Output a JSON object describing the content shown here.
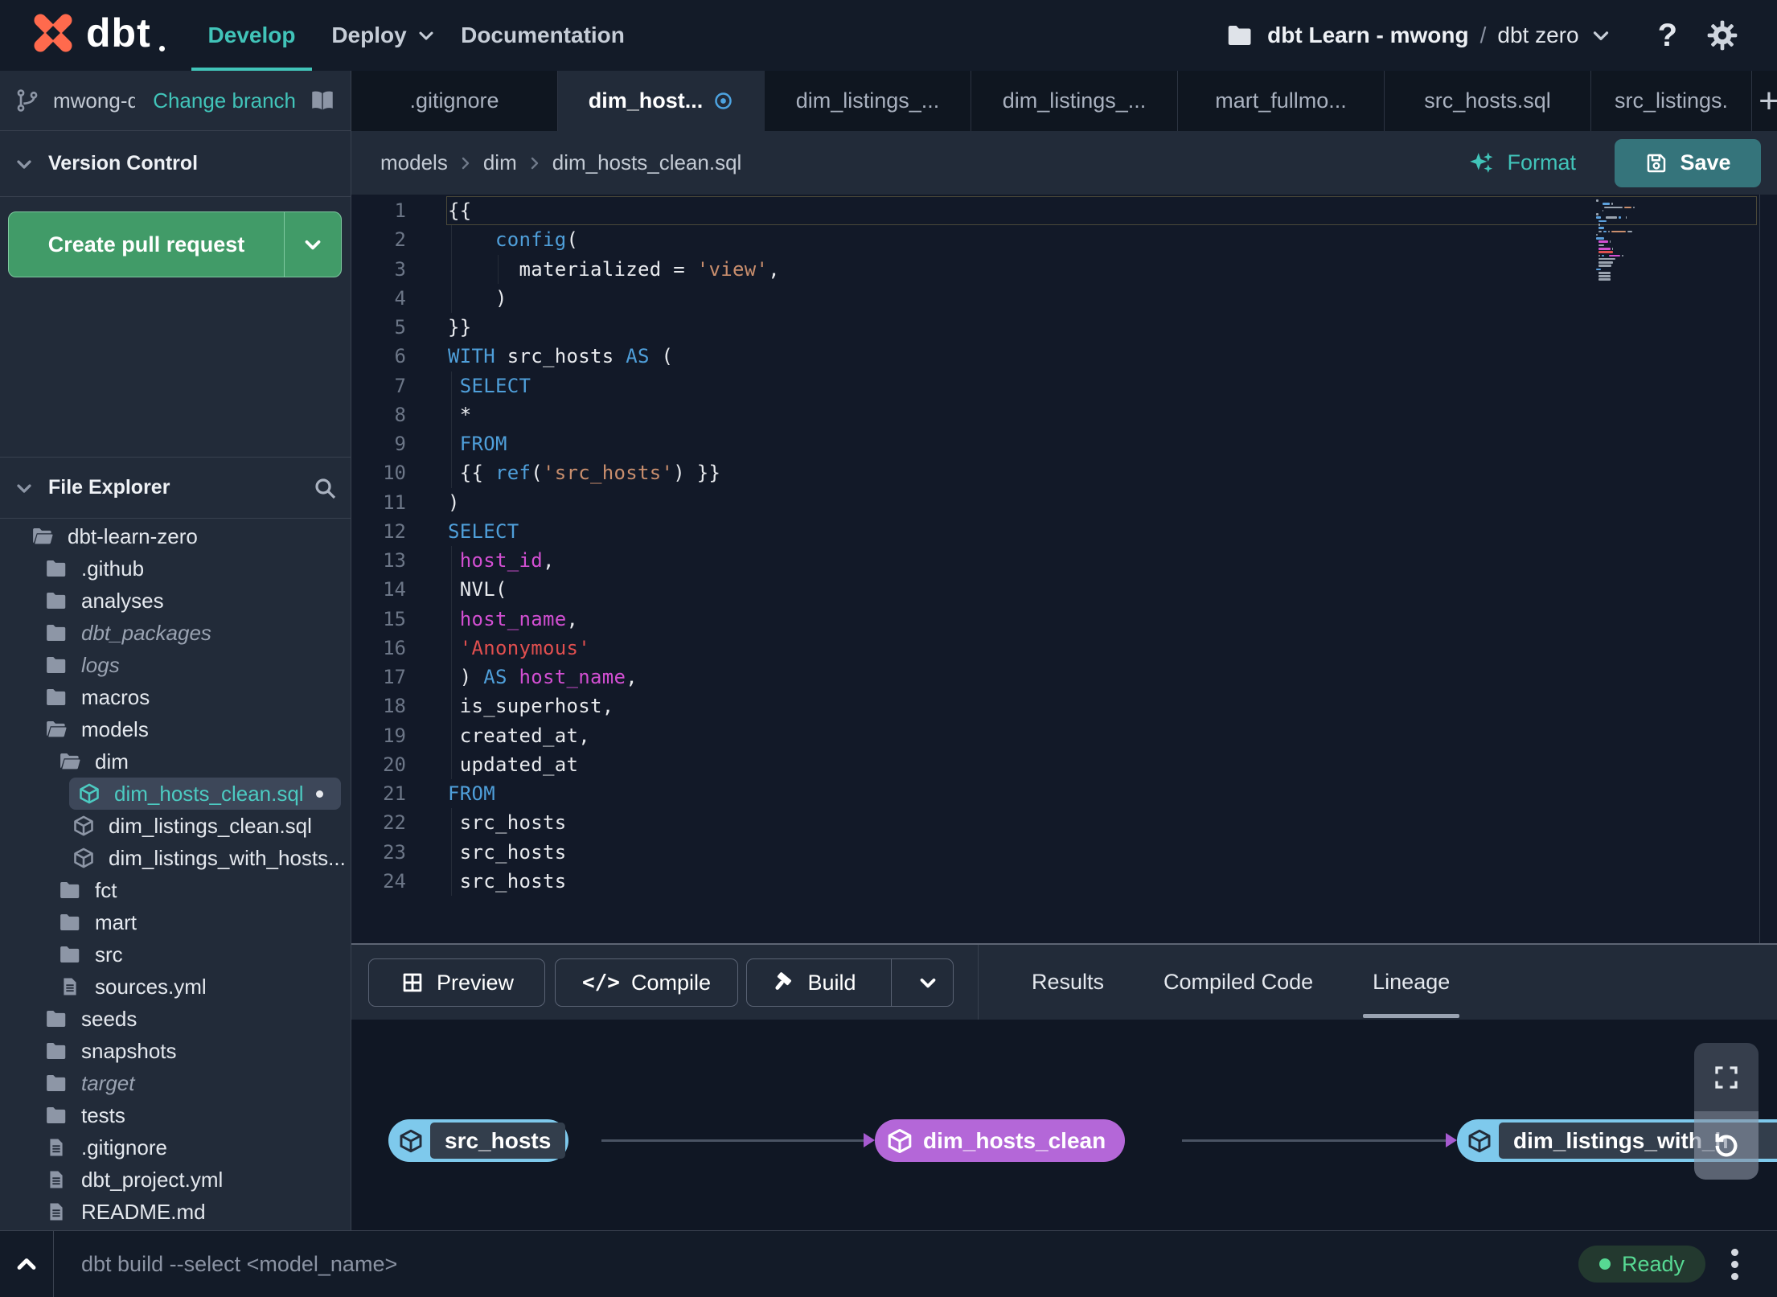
{
  "topnav": {
    "logo_text": "dbt",
    "items": [
      {
        "label": "Develop",
        "active": true,
        "chevron": false
      },
      {
        "label": "Deploy",
        "active": false,
        "chevron": true
      },
      {
        "label": "Documentation",
        "active": false,
        "chevron": false
      }
    ],
    "project_label": "dbt Learn - mwong",
    "separator": "/",
    "env_label": "dbt zero",
    "help_glyph": "?"
  },
  "branch_bar": {
    "branch_name": "mwong-d...",
    "change_branch_label": "Change branch"
  },
  "tabs": {
    "items": [
      {
        "label": ".gitignore",
        "active": false
      },
      {
        "label": "dim_host...",
        "active": true,
        "modified": true
      },
      {
        "label": "dim_listings_...",
        "active": false
      },
      {
        "label": "dim_listings_...",
        "active": false
      },
      {
        "label": "mart_fullmo...",
        "active": false
      },
      {
        "label": "src_hosts.sql",
        "active": false
      },
      {
        "label": "src_listings.",
        "active": false,
        "last": true
      }
    ],
    "new_tab_label": "+"
  },
  "breadcrumb": {
    "items": [
      "models",
      "dim",
      "dim_hosts_clean.sql"
    ]
  },
  "editor_actions": {
    "format_label": "Format",
    "save_label": "Save"
  },
  "version_control": {
    "title": "Version Control",
    "create_pr_label": "Create pull request"
  },
  "file_explorer": {
    "title": "File Explorer",
    "tree": [
      {
        "label": "dbt-learn-zero",
        "type": "folder-open",
        "level": 0
      },
      {
        "label": ".github",
        "type": "folder",
        "level": 1
      },
      {
        "label": "analyses",
        "type": "folder",
        "level": 1
      },
      {
        "label": "dbt_packages",
        "type": "folder",
        "level": 1,
        "italic": true
      },
      {
        "label": "logs",
        "type": "folder",
        "level": 1,
        "italic": true
      },
      {
        "label": "macros",
        "type": "folder",
        "level": 1
      },
      {
        "label": "models",
        "type": "folder-open",
        "level": 1
      },
      {
        "label": "dim",
        "type": "folder-open",
        "level": 2
      },
      {
        "label": "dim_hosts_clean.sql",
        "type": "model",
        "level": 3,
        "selected": true,
        "modified": true
      },
      {
        "label": "dim_listings_clean.sql",
        "type": "model",
        "level": 3
      },
      {
        "label": "dim_listings_with_hosts...",
        "type": "model",
        "level": 3
      },
      {
        "label": "fct",
        "type": "folder",
        "level": 2
      },
      {
        "label": "mart",
        "type": "folder",
        "level": 2
      },
      {
        "label": "src",
        "type": "folder",
        "level": 2
      },
      {
        "label": "sources.yml",
        "type": "file",
        "level": 2
      },
      {
        "label": "seeds",
        "type": "folder",
        "level": 1
      },
      {
        "label": "snapshots",
        "type": "folder",
        "level": 1
      },
      {
        "label": "target",
        "type": "folder",
        "level": 1,
        "italic": true
      },
      {
        "label": "tests",
        "type": "folder",
        "level": 1
      },
      {
        "label": ".gitignore",
        "type": "file",
        "level": 1
      },
      {
        "label": "dbt_project.yml",
        "type": "file",
        "level": 1
      },
      {
        "label": "README.md",
        "type": "file",
        "level": 1
      }
    ]
  },
  "editor": {
    "lines": [
      {
        "n": 1,
        "active": true,
        "seg": [
          [
            "p",
            "{{"
          ]
        ]
      },
      {
        "n": 2,
        "g": [
          0
        ],
        "seg": [
          [
            "p",
            "    "
          ],
          [
            "k",
            "config"
          ],
          [
            "p",
            "("
          ]
        ]
      },
      {
        "n": 3,
        "g": [
          0,
          58
        ],
        "seg": [
          [
            "p",
            "      materialized = "
          ],
          [
            "s",
            "'view'"
          ],
          [
            "p",
            ","
          ]
        ]
      },
      {
        "n": 4,
        "g": [
          0
        ],
        "seg": [
          [
            "p",
            "    )"
          ]
        ]
      },
      {
        "n": 5,
        "seg": [
          [
            "p",
            "}}"
          ]
        ]
      },
      {
        "n": 6,
        "seg": [
          [
            "k",
            "WITH"
          ],
          [
            "p",
            " src_hosts "
          ],
          [
            "k",
            "AS"
          ],
          [
            "p",
            " ("
          ]
        ]
      },
      {
        "n": 7,
        "g": [
          0
        ],
        "seg": [
          [
            "p",
            " "
          ],
          [
            "k",
            "SELECT"
          ]
        ]
      },
      {
        "n": 8,
        "g": [
          0
        ],
        "seg": [
          [
            "p",
            " *"
          ]
        ]
      },
      {
        "n": 9,
        "g": [
          0
        ],
        "seg": [
          [
            "p",
            " "
          ],
          [
            "k",
            "FROM"
          ]
        ]
      },
      {
        "n": 10,
        "g": [
          0
        ],
        "seg": [
          [
            "p",
            " {{ "
          ],
          [
            "k",
            "ref"
          ],
          [
            "p",
            "("
          ],
          [
            "s",
            "'src_hosts'"
          ],
          [
            "p",
            ") }}"
          ]
        ]
      },
      {
        "n": 11,
        "seg": [
          [
            "p",
            ")"
          ]
        ]
      },
      {
        "n": 12,
        "seg": [
          [
            "k",
            "SELECT"
          ]
        ]
      },
      {
        "n": 13,
        "g": [
          0
        ],
        "seg": [
          [
            "p",
            " "
          ],
          [
            "v",
            "host_id"
          ],
          [
            "p",
            ","
          ]
        ]
      },
      {
        "n": 14,
        "g": [
          0
        ],
        "seg": [
          [
            "p",
            " NVL("
          ]
        ]
      },
      {
        "n": 15,
        "g": [
          0
        ],
        "seg": [
          [
            "p",
            " "
          ],
          [
            "v",
            "host_name"
          ],
          [
            "p",
            ","
          ]
        ]
      },
      {
        "n": 16,
        "g": [
          0
        ],
        "seg": [
          [
            "p",
            " "
          ],
          [
            "r",
            "'Anonymous'"
          ]
        ]
      },
      {
        "n": 17,
        "g": [
          0
        ],
        "seg": [
          [
            "p",
            " ) "
          ],
          [
            "k",
            "AS"
          ],
          [
            "p",
            " "
          ],
          [
            "v",
            "host_name"
          ],
          [
            "p",
            ","
          ]
        ]
      },
      {
        "n": 18,
        "g": [
          0
        ],
        "seg": [
          [
            "p",
            " is_superhost,"
          ]
        ]
      },
      {
        "n": 19,
        "g": [
          0
        ],
        "seg": [
          [
            "p",
            " created_at,"
          ]
        ]
      },
      {
        "n": 20,
        "g": [
          0
        ],
        "seg": [
          [
            "p",
            " updated_at"
          ]
        ]
      },
      {
        "n": 21,
        "seg": [
          [
            "k",
            "FROM"
          ]
        ]
      },
      {
        "n": 22,
        "g": [
          0
        ],
        "seg": [
          [
            "p",
            " src_hosts"
          ]
        ]
      },
      {
        "n": 23,
        "g": [
          0
        ],
        "seg": [
          [
            "p",
            " src_hosts"
          ]
        ]
      },
      {
        "n": 24,
        "g": [
          0
        ],
        "seg": [
          [
            "p",
            " src_hosts"
          ]
        ]
      }
    ]
  },
  "bottom_panel": {
    "buttons": {
      "preview": "Preview",
      "compile": "Compile",
      "build": "Build"
    },
    "compile_glyph": "</>",
    "tabs": [
      {
        "label": "Results",
        "active": false
      },
      {
        "label": "Compiled Code",
        "active": false
      },
      {
        "label": "Lineage",
        "active": true
      }
    ]
  },
  "lineage": {
    "nodes": [
      {
        "label": "src_hosts",
        "color": "blue"
      },
      {
        "label": "dim_hosts_clean",
        "color": "purple"
      },
      {
        "label": "dim_listings_with_h",
        "color": "blue"
      }
    ]
  },
  "statusbar": {
    "command_hint": "dbt build --select <model_name>",
    "status_label": "Ready"
  },
  "colors": {
    "accent_teal": "#41c4b9",
    "button_green": "#419b68",
    "save_teal": "#35747b",
    "node_blue": "#7ec9ec",
    "node_purple": "#b467d8",
    "modified_blue": "#4da3e0",
    "status_green": "#57d993",
    "logo_orange": "#ff6a4d"
  }
}
